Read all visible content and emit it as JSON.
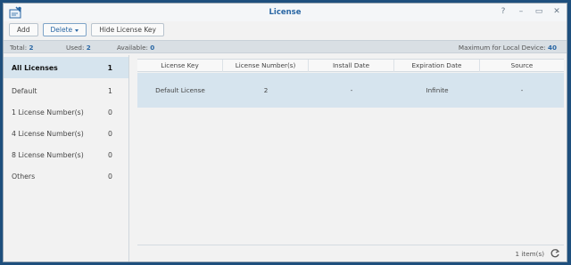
{
  "window": {
    "title": "License",
    "controls": {
      "help": "?",
      "minimize": "–",
      "maximize": "▭",
      "close": "✕"
    }
  },
  "toolbar": {
    "add_label": "Add",
    "delete_label": "Delete",
    "hide_key_label": "Hide License Key"
  },
  "summary": {
    "total_label": "Total:",
    "total_value": "2",
    "used_label": "Used:",
    "used_value": "2",
    "available_label": "Available:",
    "available_value": "0",
    "max_label": "Maximum for Local Device:",
    "max_value": "40"
  },
  "sidebar": {
    "items": [
      {
        "label": "All Licenses",
        "count": "1"
      },
      {
        "label": "Default",
        "count": "1"
      },
      {
        "label": "1 License Number(s)",
        "count": "0"
      },
      {
        "label": "4 License Number(s)",
        "count": "0"
      },
      {
        "label": "8 License Number(s)",
        "count": "0"
      },
      {
        "label": "Others",
        "count": "0"
      }
    ]
  },
  "table": {
    "columns": [
      "License Key",
      "License Number(s)",
      "Install Date",
      "Expiration Date",
      "Source"
    ],
    "rows": [
      [
        "Default License",
        "2",
        "-",
        "Infinite",
        "-"
      ]
    ]
  },
  "footer": {
    "count_label": "1 item(s)"
  },
  "colors": {
    "accent": "#2a67a4",
    "selected_row": "#d6e4ee",
    "summary_bar": "#d9dfe4"
  }
}
